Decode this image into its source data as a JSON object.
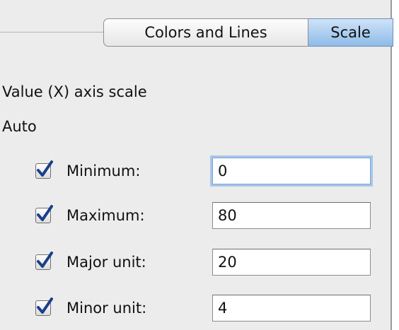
{
  "tabs": [
    {
      "label": "Colors and Lines",
      "active": false
    },
    {
      "label": "Scale",
      "active": true
    }
  ],
  "section_title": "Value (X) axis scale",
  "auto_label": "Auto",
  "rows": [
    {
      "label": "Minimum:",
      "checked": true,
      "value": "0",
      "focused": true
    },
    {
      "label": "Maximum:",
      "checked": true,
      "value": "80",
      "focused": false
    },
    {
      "label": "Major unit:",
      "checked": true,
      "value": "20",
      "focused": false
    },
    {
      "label": "Minor unit:",
      "checked": true,
      "value": "4",
      "focused": false
    }
  ],
  "colors": {
    "active_tab": "#8ebbe8",
    "check_mark": "#1a3f8a",
    "focus_ring": "#a9c6eb",
    "selection": "#d8f0a8"
  }
}
